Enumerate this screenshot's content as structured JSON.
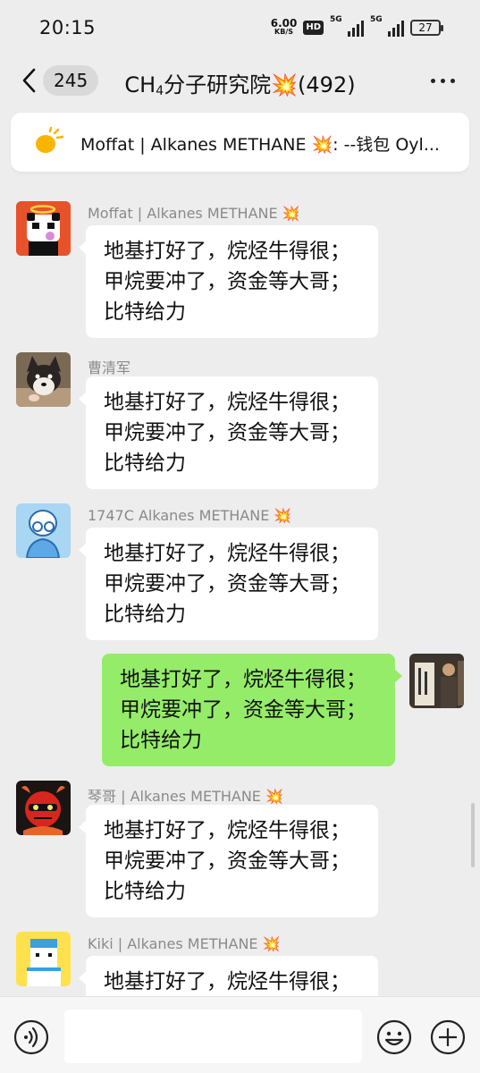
{
  "status_bar": {
    "time": "20:15",
    "net_speed_value": "6.00",
    "net_speed_unit": "KB/S",
    "hd_label": "HD",
    "network_1": "5G",
    "network_2": "5G",
    "battery": "27"
  },
  "header": {
    "unread_count": "245",
    "title_prefix": "CH",
    "title_sub": "4",
    "title_suffix": "分子研究院💥(492)"
  },
  "pinned_notice": {
    "text": "Moffat | Alkanes METHANE 💥: --钱包 Oyl..."
  },
  "messages": [
    {
      "sender": "Moffat | Alkanes METHANE 💥",
      "lines": [
        "地基打好了，烷烃牛得很；",
        "甲烷要冲了，资金等大哥；",
        "比特给力"
      ],
      "avatar": "panda-angel-avatar"
    },
    {
      "sender": "曹清军",
      "lines": [
        "地基打好了，烷烃牛得很；",
        "甲烷要冲了，资金等大哥；",
        "比特给力"
      ],
      "avatar": "shiba-dog-avatar"
    },
    {
      "sender": "1747C Alkanes METHANE 💥",
      "lines": [
        "地基打好了，烷烃牛得很；",
        "甲烷要冲了，资金等大哥；",
        "比特给力"
      ],
      "avatar": "cartoon-glasses-avatar"
    },
    {
      "sender": "",
      "lines": [
        "地基打好了，烷烃牛得很；",
        "甲烷要冲了，资金等大哥；",
        "比特给力"
      ],
      "avatar": "self-photo-avatar"
    },
    {
      "sender": "琴哥 | Alkanes METHANE 💥",
      "lines": [
        "地基打好了，烷烃牛得很；",
        "甲烷要冲了，资金等大哥；",
        "比特给力"
      ],
      "avatar": "red-helmet-avatar"
    },
    {
      "sender": "Kiki | Alkanes METHANE 💥",
      "lines": [
        "地基打好了，烷烃牛得很；"
      ],
      "avatar": "pixel-character-avatar"
    }
  ],
  "input_bar": {
    "placeholder": ""
  },
  "colors": {
    "background": "#ededed",
    "outgoing_bubble": "#95ec69",
    "incoming_bubble": "#ffffff",
    "sender_name": "#8a8a8a"
  }
}
